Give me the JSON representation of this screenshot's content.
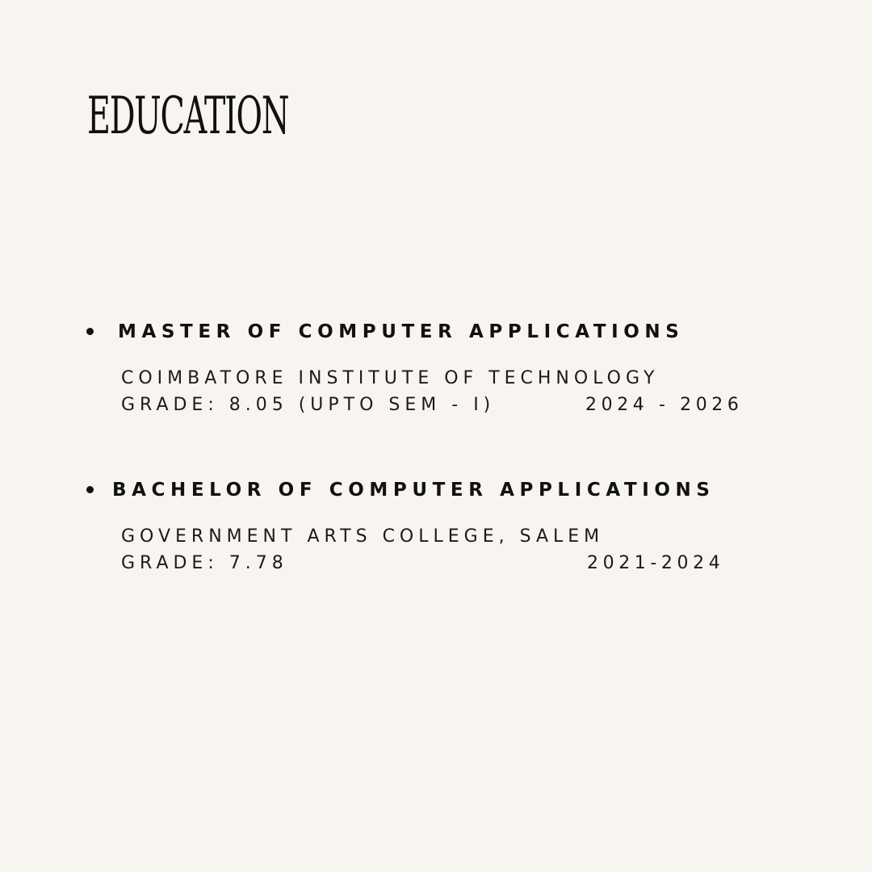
{
  "heading": "EDUCATION",
  "entries": [
    {
      "degree": "MASTER OF COMPUTER APPLICATIONS",
      "institution": "COIMBATORE INSTITUTE OF TECHNOLOGY",
      "grade": "GRADE: 8.05 (UPTO SEM - I)",
      "years": "2024 - 2026"
    },
    {
      "degree": "BACHELOR OF COMPUTER APPLICATIONS",
      "institution": "GOVERNMENT ARTS COLLEGE, SALEM",
      "grade": "GRADE: 7.78",
      "years": "2021-2024"
    }
  ],
  "colors": {
    "background": "#f8f5f1",
    "text": "#111111"
  }
}
